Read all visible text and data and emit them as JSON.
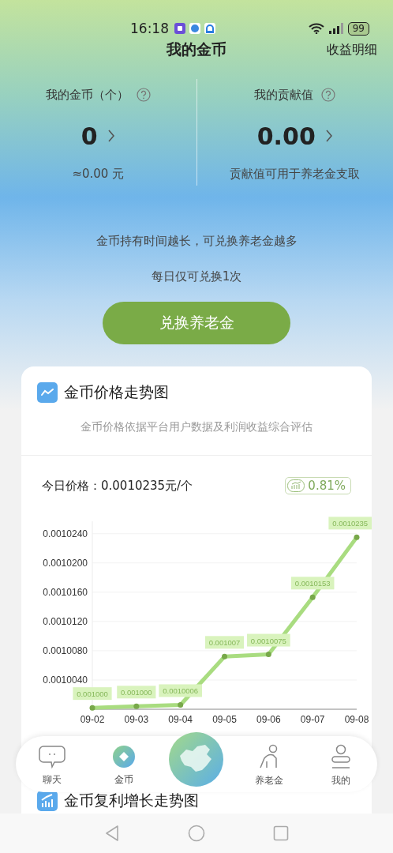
{
  "status_bar": {
    "time": "16:18",
    "battery": "99"
  },
  "header": {
    "title": "我的金币",
    "action": "收益明细"
  },
  "stats": [
    {
      "label": "我的金币（个）",
      "value": "0",
      "note": "≈0.00 元"
    },
    {
      "label": "我的贡献值",
      "value": "0.00",
      "note": "贡献值可用于养老金支取"
    }
  ],
  "info": [
    "金币持有时间越长，可兑换养老金越多",
    "每日仅可兑换1次"
  ],
  "exchange_button": "兑换养老金",
  "price_card": {
    "title": "金币价格走势图",
    "subtitle": "金币价格依据平台用户数据及利润收益综合评估",
    "today_price": "今日价格：0.0010235元/个",
    "change": "0.81%",
    "chart_data": {
      "type": "line",
      "categories": [
        "09-02",
        "09-03",
        "09-04",
        "09-05",
        "09-06",
        "09-07",
        "09-08"
      ],
      "grid": true,
      "series": [
        {
          "color": "#a9dc80",
          "marker": true,
          "values": [
            0.0010002,
            0.0010004,
            0.0010006,
            0.0010072,
            0.0010075,
            0.0010153,
            0.0010235
          ]
        }
      ],
      "ylim": [
        0.001,
        0.0010257
      ],
      "yticks": [
        {
          "value": 0.001004,
          "label": "0.0010040"
        },
        {
          "value": 0.001008,
          "label": "0.0010080"
        },
        {
          "value": 0.001012,
          "label": "0.0010120"
        },
        {
          "value": 0.001016,
          "label": "0.0010160"
        },
        {
          "value": 0.00102,
          "label": "0.0010200"
        },
        {
          "value": 0.001024,
          "label": "0.0010240"
        }
      ],
      "value_labels": [
        "0.001000",
        "0.001000",
        "0.0010006",
        "0.001007",
        "0.0010075",
        "0.0010153",
        "0.0010235"
      ]
    }
  },
  "growth_card": {
    "title": "金币复利增长走势图"
  },
  "nav": [
    {
      "label": "聊天",
      "selected": false
    },
    {
      "label": "金币",
      "selected": true
    },
    {
      "label": "养老金",
      "selected": false
    },
    {
      "label": "我的",
      "selected": false
    }
  ]
}
